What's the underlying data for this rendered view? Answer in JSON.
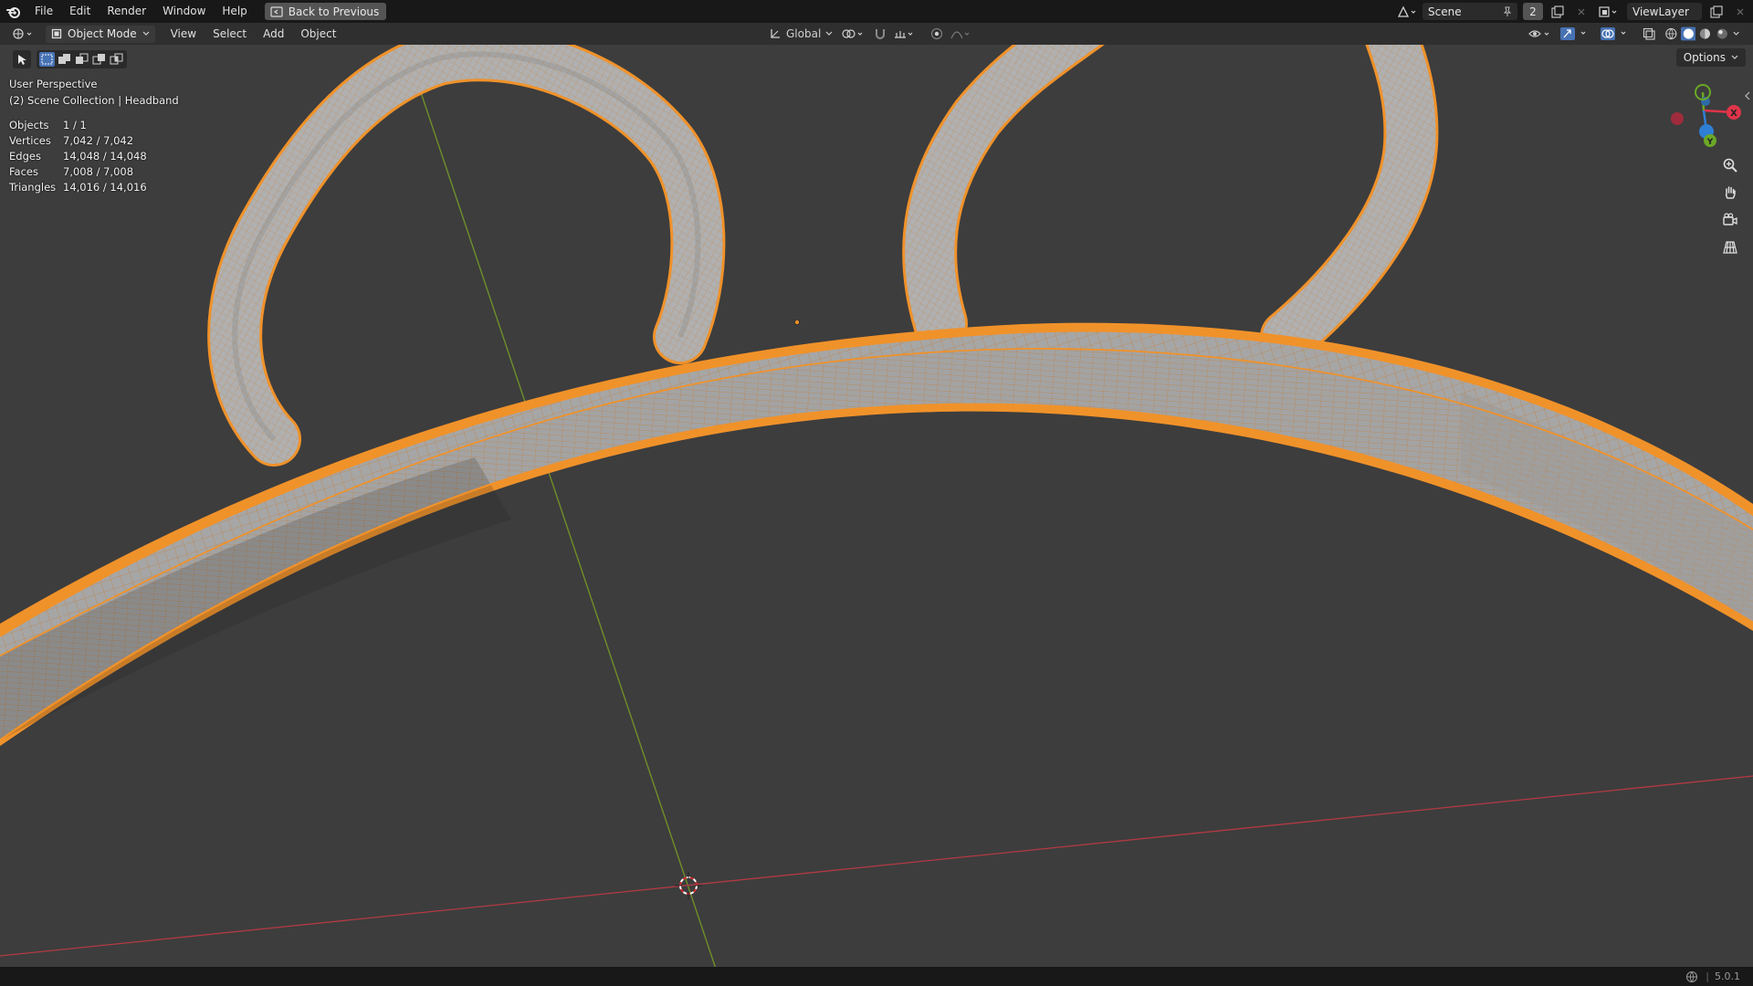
{
  "menubar": {
    "items": [
      "File",
      "Edit",
      "Render",
      "Window",
      "Help"
    ],
    "back_label": "Back to Previous",
    "scene_name": "Scene",
    "scene_users": "2",
    "view_layer": "ViewLayer"
  },
  "viewport_header": {
    "mode": "Object Mode",
    "menus": [
      "View",
      "Select",
      "Add",
      "Object"
    ],
    "orientation": "Global",
    "options_label": "Options"
  },
  "overlay": {
    "view_name": "User Perspective",
    "collection": "(2) Scene Collection | Headband",
    "stats": [
      {
        "label": "Objects",
        "value": "1 / 1"
      },
      {
        "label": "Vertices",
        "value": "7,042 / 7,042"
      },
      {
        "label": "Edges",
        "value": "14,048 / 14,048"
      },
      {
        "label": "Faces",
        "value": "7,008 / 7,008"
      },
      {
        "label": "Triangles",
        "value": "14,016 / 14,016"
      }
    ]
  },
  "gizmo": {
    "x_label": "X",
    "y_label": "Y",
    "z_label": "Z",
    "x_color": "#e0344a",
    "y_color": "#6aa826",
    "z_color": "#2f7fd4"
  },
  "status": {
    "version": "5.0.1"
  },
  "colors": {
    "selection": "#f0922a",
    "mesh": "#a9a9a9",
    "background": "#3d3d3d",
    "axis_x": "#b23a44",
    "axis_y": "#6f8f2a"
  }
}
